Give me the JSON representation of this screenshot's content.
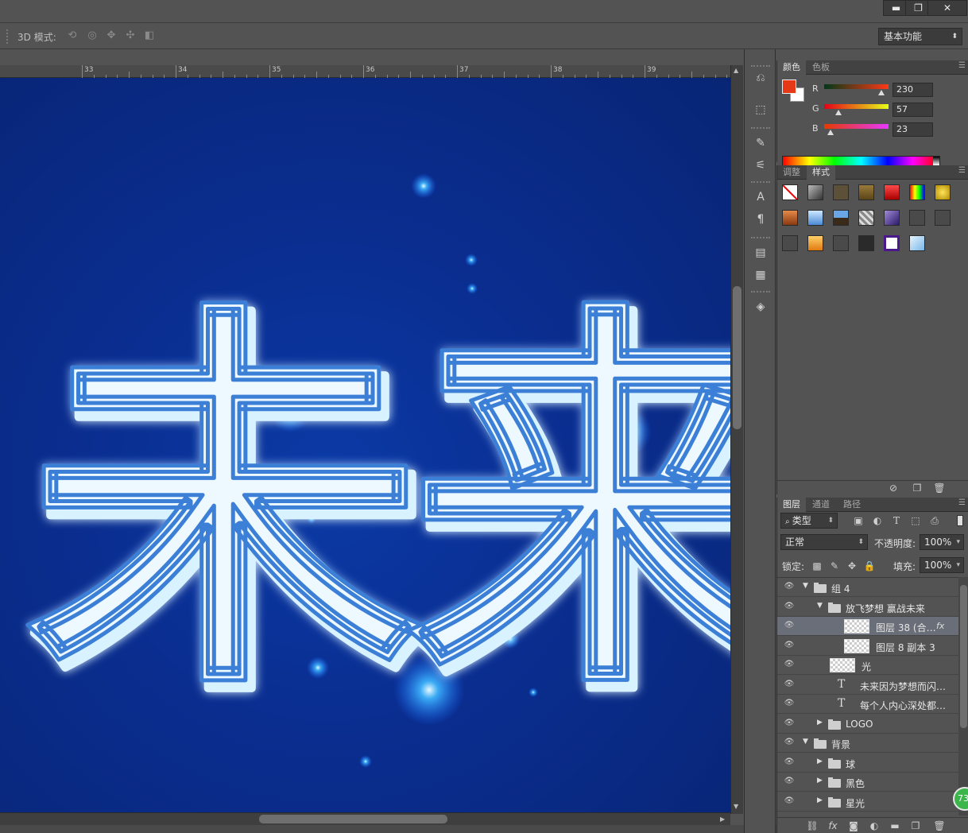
{
  "window": {
    "minimize_label": "▬",
    "restore_label": "❐",
    "close_label": "✕"
  },
  "options_bar": {
    "mode_label": "3D 模式:",
    "icons": [
      "rotate-3d-icon",
      "roll-3d-icon",
      "drag-3d-icon",
      "slide-3d-icon",
      "scale-3d-icon"
    ],
    "workspace": "基本功能"
  },
  "ruler": {
    "labels": [
      "33",
      "34",
      "35",
      "36",
      "37",
      "38",
      "39"
    ]
  },
  "artwork": {
    "characters": [
      "未",
      "来"
    ],
    "text_color": "#eef8ff",
    "outline_color": "#3b7fd6",
    "background_color": "#0a2d8f"
  },
  "color_panel": {
    "tabs": [
      "颜色",
      "色板"
    ],
    "foreground": "#e63917",
    "background": "#ffffff",
    "channels": [
      {
        "label": "R",
        "value": "230"
      },
      {
        "label": "G",
        "value": "57"
      },
      {
        "label": "B",
        "value": "23"
      }
    ]
  },
  "styles_panel": {
    "tabs": [
      "调整",
      "样式"
    ]
  },
  "layers_panel": {
    "tabs": [
      "图层",
      "通道",
      "路径"
    ],
    "filter_kind": "类型",
    "blend_mode": "正常",
    "opacity_label": "不透明度:",
    "opacity_value": "100%",
    "lock_label": "锁定:",
    "fill_label": "填充:",
    "fill_value": "100%",
    "layers": [
      {
        "name": "组 4",
        "type": "group",
        "expanded": true,
        "indent": 0
      },
      {
        "name": "放飞梦想 赢战未来",
        "type": "group",
        "expanded": true,
        "indent": 1
      },
      {
        "name": "图层 38 (合…",
        "type": "pixel",
        "indent": 2,
        "selected": true,
        "fx": "fx"
      },
      {
        "name": "图层 8 副本 3",
        "type": "pixel",
        "indent": 2
      },
      {
        "name": "光",
        "type": "pixel",
        "indent": 1
      },
      {
        "name": "未来因为梦想而闪…",
        "type": "text",
        "indent": 1
      },
      {
        "name": "每个人内心深处都…",
        "type": "text",
        "indent": 1
      },
      {
        "name": "LOGO",
        "type": "group",
        "expanded": false,
        "indent": 1
      },
      {
        "name": "背景",
        "type": "group",
        "expanded": true,
        "indent": 0
      },
      {
        "name": "球",
        "type": "group",
        "expanded": false,
        "indent": 1
      },
      {
        "name": "黑色",
        "type": "group",
        "expanded": false,
        "indent": 1
      },
      {
        "name": "星光",
        "type": "group",
        "expanded": false,
        "indent": 1
      }
    ],
    "badge": "73"
  }
}
